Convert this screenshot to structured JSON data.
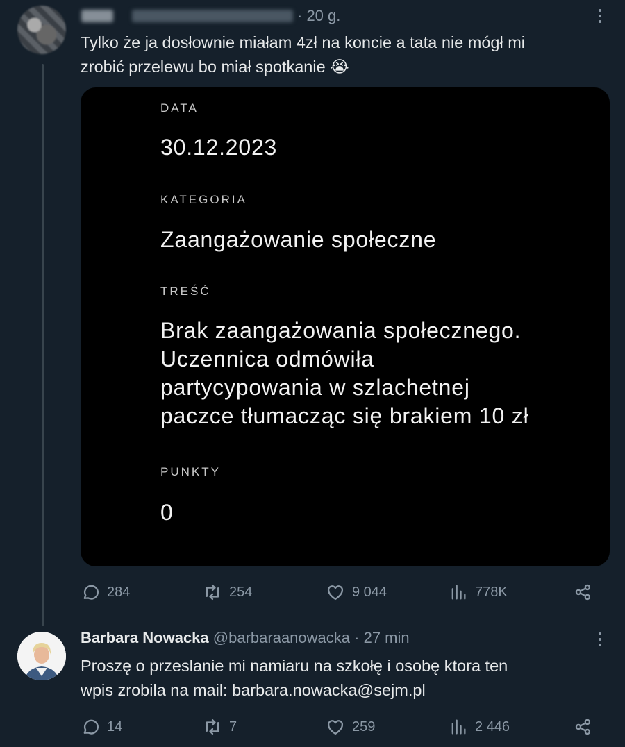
{
  "tweet1": {
    "time": "· 20 g.",
    "text_line1": "Tylko że ja dosłownie miałam 4zł na koncie a tata nie mógł mi",
    "text_line2": "zrobić przelewu bo miał spotkanie 😭",
    "card": {
      "data_label": "DATA",
      "data_value": "30.12.2023",
      "kategoria_label": "KATEGORIA",
      "kategoria_value": "Zaangażowanie społeczne",
      "tresc_label": "TREŚĆ",
      "tresc_line1": "Brak zaangażowania społecznego.",
      "tresc_line2": "Uczennica odmówiła",
      "tresc_line3": "partycypowania w szlachetnej",
      "tresc_line4": "paczce tłumacząc się brakiem 10 zł",
      "punkty_label": "PUNKTY",
      "punkty_value": "0"
    },
    "replies": "284",
    "reposts": "254",
    "likes": "9 044",
    "views": "778K"
  },
  "tweet2": {
    "name": "Barbara Nowacka",
    "handle": "@barbaraanowacka",
    "time": "· 27 min",
    "text_line1": "Proszę o przeslanie mi namiaru na szkołę i osobę ktora ten",
    "text_line2": "wpis zrobila na mail: barbara.nowacka@sejm.pl",
    "replies": "14",
    "reposts": "7",
    "likes": "259",
    "views": "2 446"
  },
  "icons": {
    "reply": "reply-icon",
    "repost": "repost-icon",
    "like": "heart-icon",
    "views": "views-icon",
    "share": "share-icon",
    "more": "more-icon"
  },
  "colors": {
    "background": "#15202b",
    "card_background": "#000000",
    "muted_text": "#8b98a5"
  }
}
